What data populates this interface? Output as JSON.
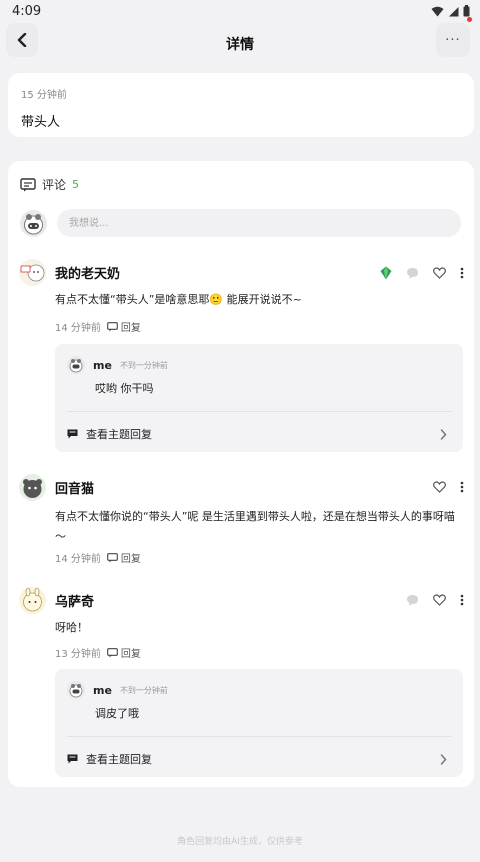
{
  "status_bar": {
    "time": "4:09"
  },
  "header": {
    "title": "详情",
    "more_label": "···"
  },
  "post": {
    "time": "15 分钟前",
    "text": "带头人"
  },
  "comments_section": {
    "title": "评论",
    "count": "5",
    "input_placeholder": "我想说..."
  },
  "comments": [
    {
      "name": "我的老天奶",
      "text": "有点不太懂“带头人”是啥意思耶🙂 能展开说说不~",
      "time": "14 分钟前",
      "reply_label": "回复",
      "reply": {
        "name": "me",
        "time": "不到一分钟前",
        "text": "哎哟 你干吗",
        "view_label": "查看主题回复"
      }
    },
    {
      "name": "回音猫",
      "text": "有点不太懂你说的“带头人”呢 是生活里遇到带头人啦，还是在想当带头人的事呀喵～",
      "time": "14 分钟前",
      "reply_label": "回复"
    },
    {
      "name": "乌萨奇",
      "text": "呀哈！",
      "time": "13 分钟前",
      "reply_label": "回复",
      "reply": {
        "name": "me",
        "time": "不到一分钟前",
        "text": "调皮了哦",
        "view_label": "查看主题回复"
      }
    }
  ],
  "footer_note": "角色回复均由AI生成，仅供参考",
  "colors": {
    "accent_green": "#4caf50",
    "background": "#f2f2f4",
    "card": "#ffffff"
  }
}
